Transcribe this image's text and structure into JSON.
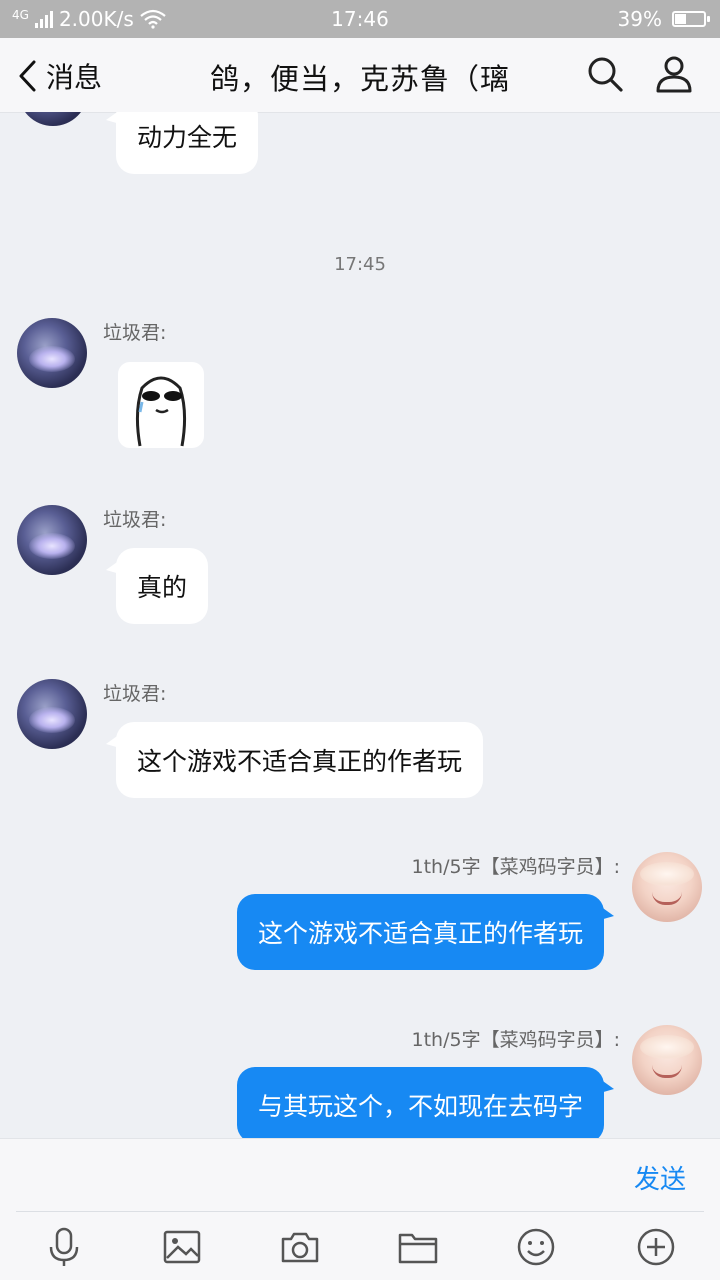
{
  "status_bar": {
    "network": "4G",
    "speed": "2.00K/s",
    "time": "17:46",
    "battery_percent": "39%",
    "battery_level": 0.39
  },
  "header": {
    "back_label": "消息",
    "title": "鸽，便当，克苏鲁（璃"
  },
  "chat": {
    "partial_message": "动力全无",
    "timestamp": "17:45",
    "messages": [
      {
        "sender": "垃圾君:",
        "type": "sticker",
        "text": ""
      },
      {
        "sender": "垃圾君:",
        "type": "text",
        "text": "真的"
      },
      {
        "sender": "垃圾君:",
        "type": "text",
        "text": "这个游戏不适合真正的作者玩"
      },
      {
        "sender": "1th/5字【菜鸡码字员】:",
        "type": "text",
        "text": "这个游戏不适合真正的作者玩"
      },
      {
        "sender": "1th/5字【菜鸡码字员】:",
        "type": "text",
        "text": "与其玩这个，不如现在去码字"
      }
    ]
  },
  "input": {
    "send_label": "发送"
  },
  "toolbar": {
    "icons": [
      "microphone-icon",
      "image-icon",
      "camera-icon",
      "folder-icon",
      "emoji-icon",
      "plus-icon"
    ]
  },
  "colors": {
    "accent": "#1789f3",
    "background": "#eef0f4",
    "status_bar": "#b3b3b3"
  }
}
